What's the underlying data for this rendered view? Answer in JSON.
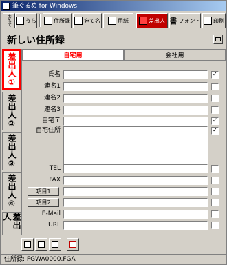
{
  "window": {
    "title": "筆ぐるめ for Windows"
  },
  "toolbar": {
    "buttons": [
      {
        "label": "おもて"
      },
      {
        "label": "うら"
      },
      {
        "label": "住所録"
      },
      {
        "label": "宛て名"
      },
      {
        "label": "用紙"
      },
      {
        "label": "差出人"
      },
      {
        "label": "フォント"
      },
      {
        "label": "印刷"
      }
    ]
  },
  "header": {
    "title": "新しい住所録"
  },
  "side_tabs": [
    {
      "label": "差出人①"
    },
    {
      "label": "差出人②"
    },
    {
      "label": "差出人③"
    },
    {
      "label": "差出人④"
    },
    {
      "label": "差出人"
    }
  ],
  "tabs": [
    {
      "label": "自宅用"
    },
    {
      "label": "会社用"
    }
  ],
  "form": {
    "rows": [
      {
        "label": "氏名",
        "value": "",
        "checked": true
      },
      {
        "label": "連名1",
        "value": "",
        "checked": false
      },
      {
        "label": "連名2",
        "value": "",
        "checked": false
      },
      {
        "label": "連名3",
        "value": "",
        "checked": false
      },
      {
        "label": "自宅〒",
        "value": "",
        "checked": true
      },
      {
        "label": "自宅住所",
        "value": "",
        "checked": true
      },
      {
        "label": "TEL",
        "value": "",
        "checked": false
      },
      {
        "label": "FAX",
        "value": "",
        "checked": false
      },
      {
        "label": "項目1",
        "value": "",
        "checked": false
      },
      {
        "label": "項目2",
        "value": "",
        "checked": false
      },
      {
        "label": "E-Mail",
        "value": "",
        "checked": false
      },
      {
        "label": "URL",
        "value": "",
        "checked": false
      }
    ],
    "check_mark": "✓"
  },
  "bottom_toolbar": {
    "icons": [
      "copy-icon",
      "paste-icon",
      "trash-icon",
      "switch-icon"
    ]
  },
  "status": {
    "text": "住所録: FGWA0000.FGA"
  },
  "colors": {
    "active": "#ff0000",
    "title_start": "#0a246a",
    "title_end": "#a6caf0",
    "face": "#d4d0c8"
  }
}
